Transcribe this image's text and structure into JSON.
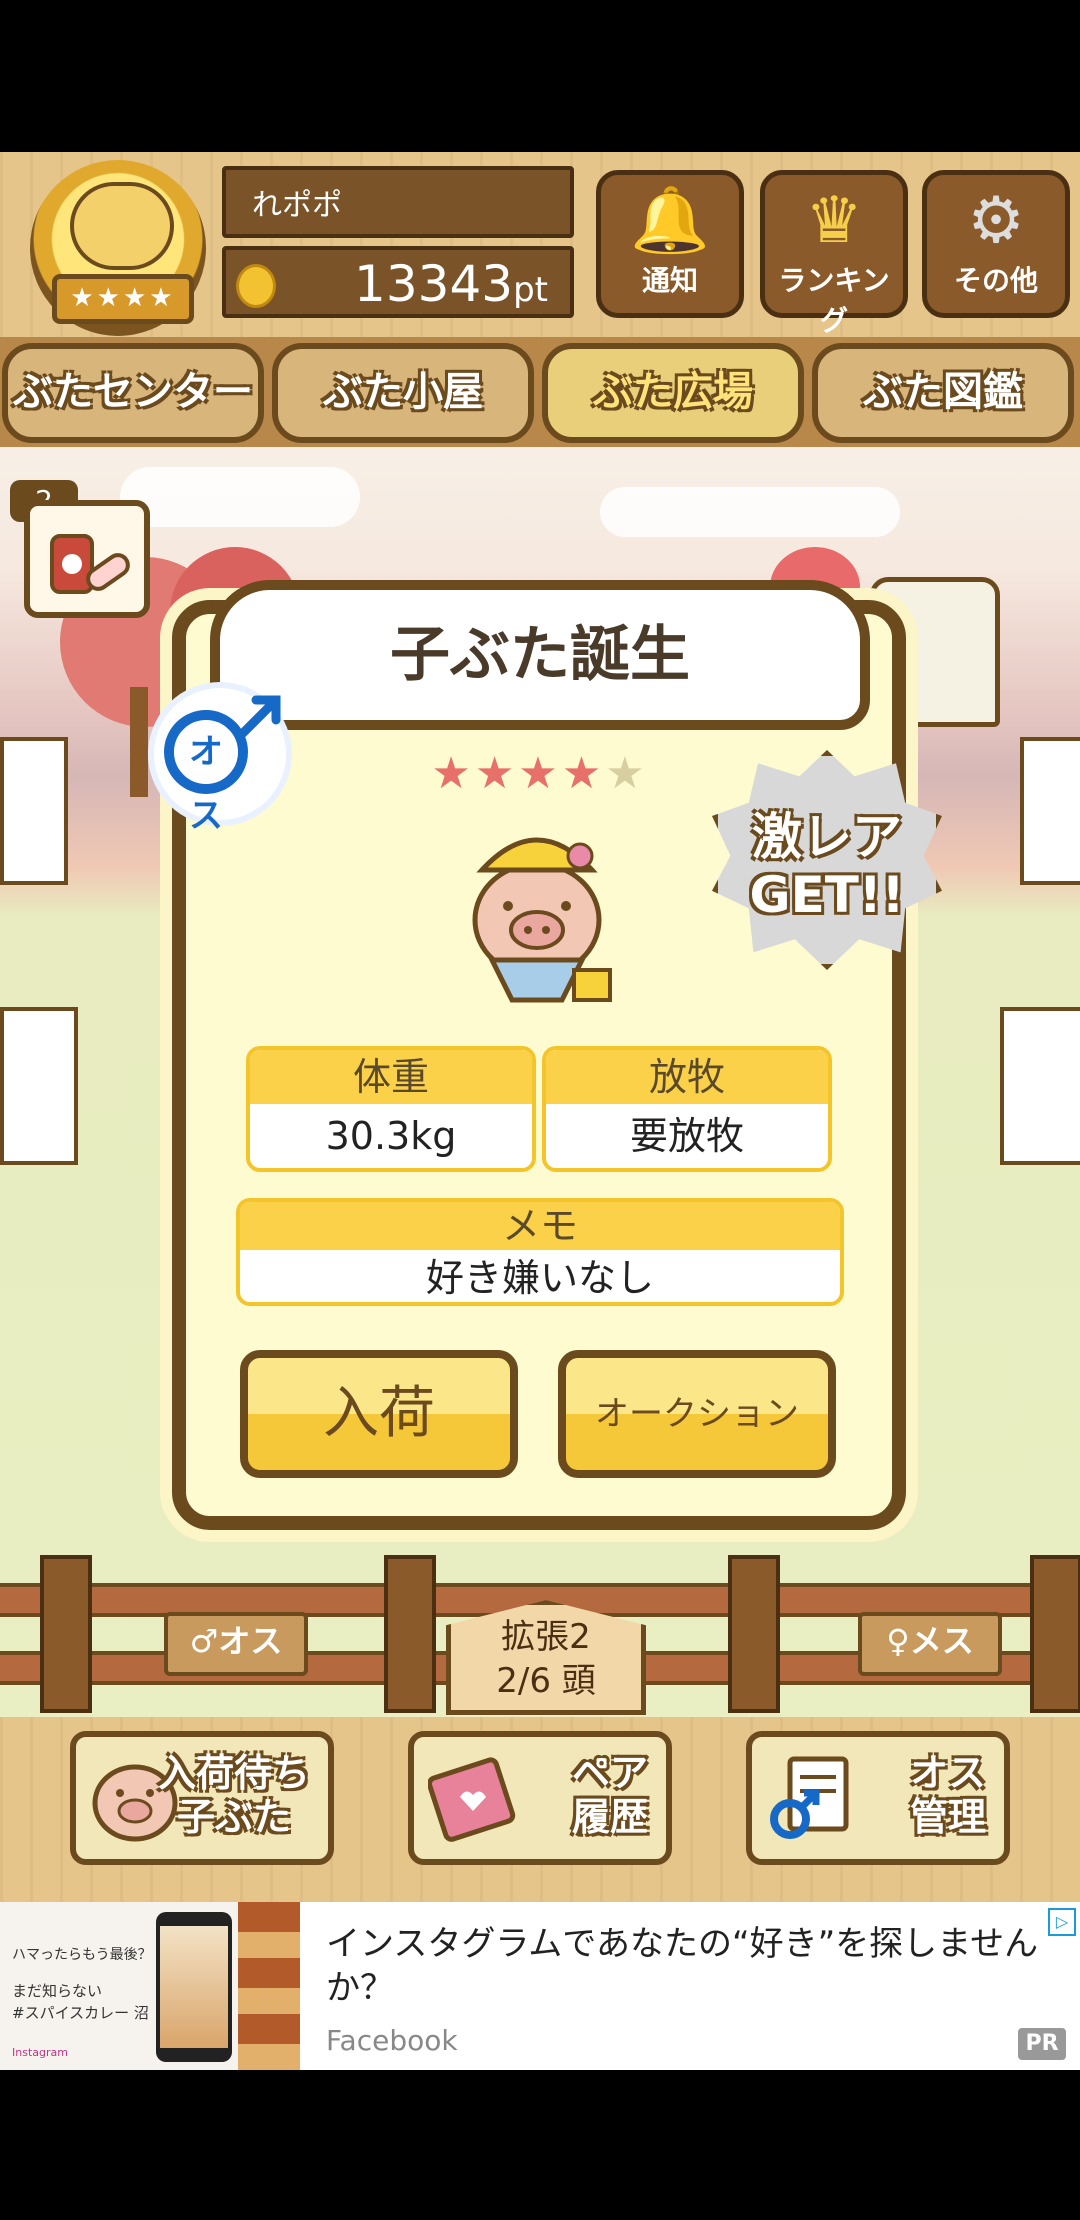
{
  "header": {
    "medal_stars": "★★★★",
    "user_name": "れポポ",
    "points": "13343",
    "points_unit": "pt",
    "buttons": [
      {
        "icon": "bell-icon",
        "glyph": "🔔",
        "label": "通知"
      },
      {
        "icon": "crown-icon",
        "glyph": "♛",
        "label": "ランキング"
      },
      {
        "icon": "gear-icon",
        "glyph": "⚙",
        "label": "その他"
      }
    ]
  },
  "tabs": [
    {
      "label": "ぶたセンター",
      "active": false
    },
    {
      "label": "ぶた小屋",
      "active": false
    },
    {
      "label": "ぶた広場",
      "active": true
    },
    {
      "label": "ぶた図鑑",
      "active": false
    }
  ],
  "item": {
    "count": "2",
    "icon": "medicine-icon"
  },
  "modal": {
    "title": "子ぶた誕生",
    "gender_label": "オス",
    "stars": {
      "filled": 4,
      "total": 5
    },
    "rare_line1": "激レア",
    "rare_line2": "GET!!",
    "weight": {
      "label": "体重",
      "value": "30.3kg"
    },
    "grazing": {
      "label": "放牧",
      "value": "要放牧"
    },
    "memo": {
      "label": "メモ",
      "value": "好き嫌いなし"
    },
    "stock_button": "入荷",
    "auction_button": "オークション"
  },
  "field": {
    "male_sign": "♂オス",
    "female_sign": "♀メス",
    "expand_line1": "拡張2",
    "expand_line2": "2/6 頭"
  },
  "bottom": [
    {
      "label_1": "入荷待ち",
      "label_2": "子ぶた",
      "icon": "piglet-icon"
    },
    {
      "label_1": "ペア",
      "label_2": "履歴",
      "icon": "book-icon"
    },
    {
      "label_1": "オス",
      "label_2": "管理",
      "icon": "male-document-icon"
    }
  ],
  "ad": {
    "thumb_line1": "ハマったらもう最後？",
    "thumb_line2": "まだ知らない",
    "thumb_line3": "#スパイスカレー 沼",
    "thumb_brand": "Instagram",
    "title": "インスタグラムであなたの“好き”を探しませんか？",
    "source": "Facebook",
    "pr": "PR"
  },
  "colors": {
    "wood_dark": "#6b4a1e",
    "panel_yellow": "#fffbd0",
    "accent_yellow": "#fcd14a",
    "male_blue": "#1769c8",
    "female_red": "#e0323a",
    "star_pink": "#e8706a"
  }
}
